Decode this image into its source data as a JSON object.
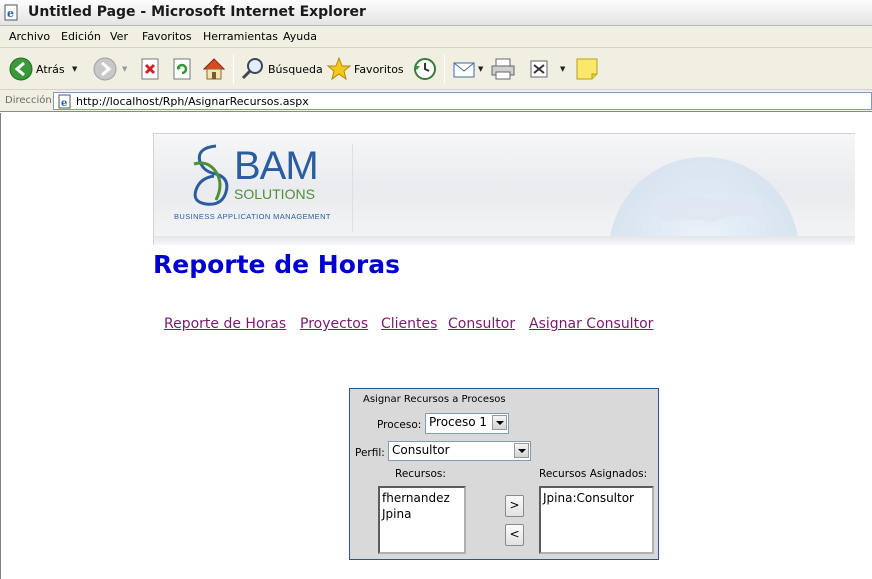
{
  "window": {
    "title": "Untitled Page - Microsoft Internet Explorer"
  },
  "menu": [
    "Archivo",
    "Edición",
    "Ver",
    "Favoritos",
    "Herramientas",
    "Ayuda"
  ],
  "toolbar": {
    "back_label": "Atrás",
    "search_label": "Búsqueda",
    "favorites_label": "Favoritos"
  },
  "address": {
    "label": "Dirección",
    "url": "http://localhost/Rph/AsignarRecursos.aspx"
  },
  "banner": {
    "logo_main": "BAM",
    "logo_sub": "SOLUTIONS",
    "tagline": "BUSINESS APPLICATION MANAGEMENT"
  },
  "page": {
    "title": "Reporte de Horas",
    "nav": [
      "Reporte de Horas",
      "Proyectos",
      "Clientes",
      "Consultor",
      "Asignar Consultor"
    ]
  },
  "panel": {
    "title": "Asignar Recursos a Procesos",
    "proceso_label": "Proceso:",
    "proceso_value": "Proceso 1",
    "perfil_label": "Perfil:",
    "perfil_value": "Consultor",
    "recursos_label": "Recursos:",
    "asignados_label": "Recursos Asignados:",
    "recursos": [
      "fhernandez",
      "Jpina"
    ],
    "asignados": [
      "Jpina:Consultor"
    ],
    "add_button": ">",
    "remove_button": "<"
  },
  "colors": {
    "title_link": "#0000d0",
    "nav_link": "#7a1a6f",
    "panel_border": "#3050a0",
    "panel_bg": "#d9d9d9"
  }
}
